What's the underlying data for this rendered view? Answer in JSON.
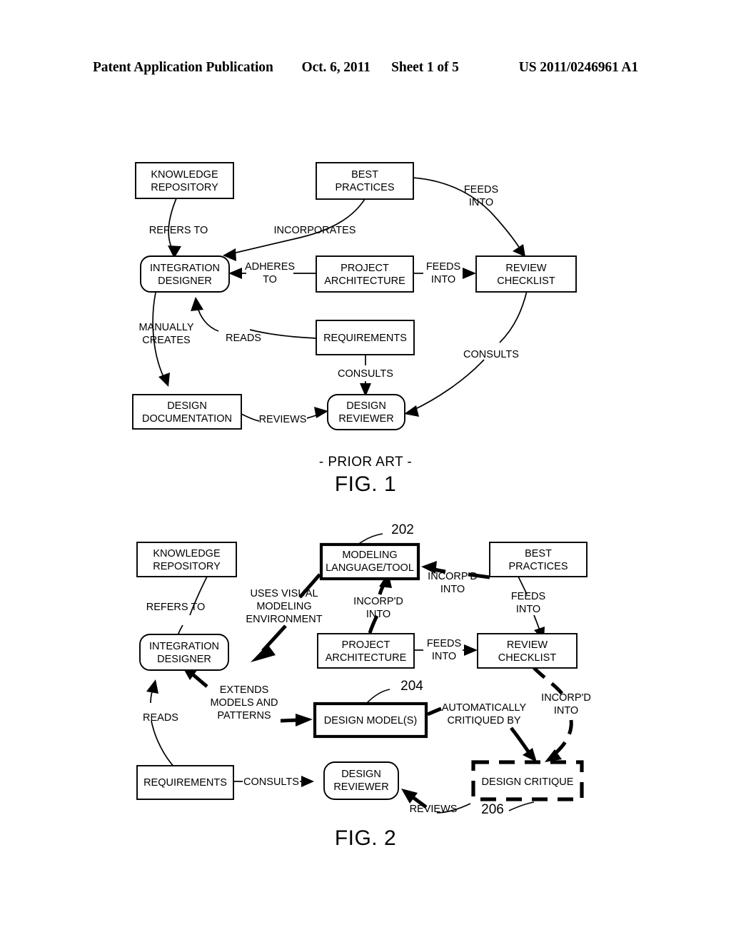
{
  "header": {
    "publication": "Patent Application Publication",
    "date": "Oct. 6, 2011",
    "sheet": "Sheet 1 of 5",
    "patent_number": "US 2011/0246961 A1"
  },
  "figure1": {
    "prior_art_label": "- PRIOR ART -",
    "caption": "FIG. 1",
    "nodes": {
      "knowledge_repository": {
        "line1": "KNOWLEDGE",
        "line2": "REPOSITORY"
      },
      "best_practices": {
        "line1": "BEST",
        "line2": "PRACTICES"
      },
      "integration_designer": {
        "line1": "INTEGRATION",
        "line2": "DESIGNER"
      },
      "project_architecture": {
        "line1": "PROJECT",
        "line2": "ARCHITECTURE"
      },
      "review_checklist": {
        "line1": "REVIEW",
        "line2": "CHECKLIST"
      },
      "requirements": {
        "line1": "REQUIREMENTS"
      },
      "design_documentation": {
        "line1": "DESIGN",
        "line2": "DOCUMENTATION"
      },
      "design_reviewer": {
        "line1": "DESIGN",
        "line2": "REVIEWER"
      }
    },
    "edges": {
      "refers_to": "REFERS TO",
      "incorporates": "INCORPORATES",
      "feeds_into_bp": {
        "line1": "FEEDS",
        "line2": "INTO"
      },
      "adheres_to": {
        "line1": "ADHERES",
        "line2": "TO"
      },
      "feeds_into_pa": {
        "line1": "FEEDS",
        "line2": "INTO"
      },
      "manually_creates": {
        "line1": "MANUALLY",
        "line2": "CREATES"
      },
      "reads": "READS",
      "consults_req": "CONSULTS",
      "consults_rc": "CONSULTS",
      "reviews": "REVIEWS"
    }
  },
  "figure2": {
    "caption": "FIG. 2",
    "nodes": {
      "knowledge_repository": {
        "line1": "KNOWLEDGE",
        "line2": "REPOSITORY"
      },
      "modeling_language_tool": {
        "line1": "MODELING",
        "line2": "LANGUAGE/TOOL",
        "ref": "202"
      },
      "best_practices": {
        "line1": "BEST",
        "line2": "PRACTICES"
      },
      "integration_designer": {
        "line1": "INTEGRATION",
        "line2": "DESIGNER"
      },
      "project_architecture": {
        "line1": "PROJECT",
        "line2": "ARCHITECTURE"
      },
      "review_checklist": {
        "line1": "REVIEW",
        "line2": "CHECKLIST"
      },
      "design_models": {
        "line1": "DESIGN MODEL(S)",
        "ref": "204"
      },
      "requirements": {
        "line1": "REQUIREMENTS"
      },
      "design_reviewer": {
        "line1": "DESIGN",
        "line2": "REVIEWER"
      },
      "design_critique": {
        "line1": "DESIGN CRITIQUE",
        "ref": "206"
      }
    },
    "edges": {
      "refers_to": "REFERS TO",
      "uses_visual_modeling_environment": {
        "line1": "USES VISUAL",
        "line2": "MODELING",
        "line3": "ENVIRONMENT"
      },
      "incorpd_into_pa": {
        "line1": "INCORP'D",
        "line2": "INTO"
      },
      "incorpd_into_bp": {
        "line1": "INCORP'D",
        "line2": "INTO"
      },
      "feeds_into_bp": {
        "line1": "FEEDS",
        "line2": "INTO"
      },
      "feeds_into_pa": {
        "line1": "FEEDS",
        "line2": "INTO"
      },
      "extends_models_and_patterns": {
        "line1": "EXTENDS",
        "line2": "MODELS AND",
        "line3": "PATTERNS"
      },
      "reads": "READS",
      "automatically_critiqued_by": {
        "line1": "AUTOMATICALLY",
        "line2": "CRITIQUED BY"
      },
      "incorpd_into_rc": {
        "line1": "INCORP'D",
        "line2": "INTO"
      },
      "consults": "CONSULTS",
      "reviews": "REVIEWS"
    }
  }
}
